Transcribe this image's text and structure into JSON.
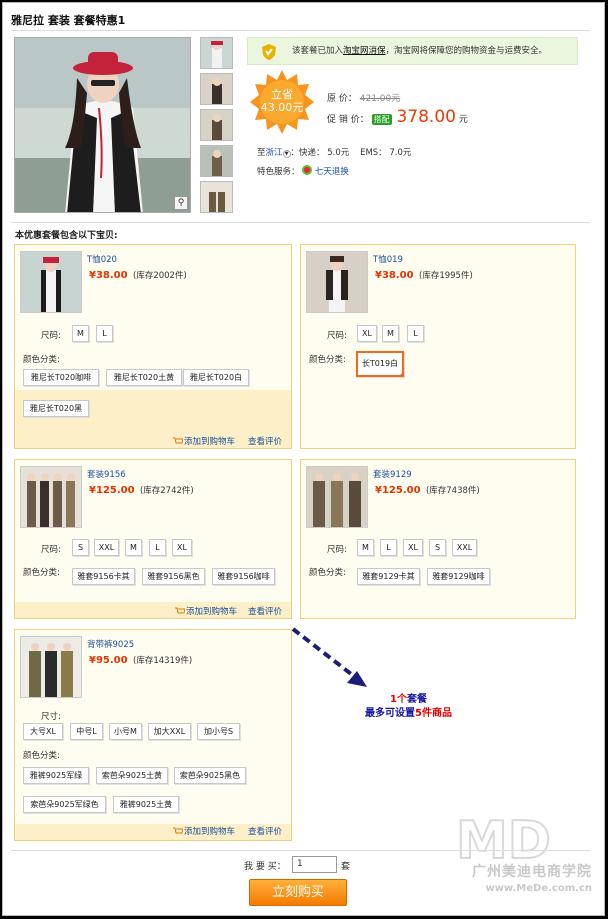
{
  "title": "雅尼拉  套装  套餐特惠1",
  "notice": {
    "prefix": "该套餐已加入",
    "link": "淘宝网消保",
    "suffix": "，淘宝网将保障您的购物资金与运费安全。"
  },
  "savings": {
    "line1": "立省",
    "line2": "43.00元"
  },
  "price": {
    "original_label": "原       价：",
    "original_value": "421.00元",
    "promo_label": "促 销 价：",
    "promo_tag": "搭配",
    "promo_value": "378.00",
    "promo_unit": "元"
  },
  "shipping": {
    "prefix": "至",
    "region": "浙江",
    "express": "：快递： 5.0元",
    "ems": "EMS： 7.0元"
  },
  "service": {
    "label": "特色服务：",
    "link": "七天退换"
  },
  "includes_label": "本优惠套餐包含以下宝贝:",
  "items": [
    {
      "name": "T恤020",
      "price": "¥38.00",
      "stock": "(库存2002件)",
      "size_label": "尺码:",
      "sizes": [
        "M",
        "L"
      ],
      "color_label": "颜色分类:",
      "colors": [
        "雅尼长T020咖啡",
        "雅尼长T020土黄",
        "雅尼长T020白",
        "雅尼长T020黑"
      ],
      "cart": "添加到购物车",
      "review": "查看评价"
    },
    {
      "name": "T恤019",
      "price": "¥38.00",
      "stock": "(库存1995件)",
      "size_label": "尺码:",
      "sizes": [
        "XL",
        "M",
        "L"
      ],
      "color_label": "颜色分类:",
      "colors": [
        "长T019白"
      ]
    },
    {
      "name": "套装9156",
      "price": "¥125.00",
      "stock": "(库存2742件)",
      "size_label": "尺码:",
      "sizes": [
        "S",
        "XXL",
        "M",
        "L",
        "XL"
      ],
      "color_label": "颜色分类:",
      "colors": [
        "雅套9156卡其",
        "雅套9156黑色",
        "雅套9156咖啡"
      ],
      "cart": "添加到购物车",
      "review": "查看评价"
    },
    {
      "name": "套装9129",
      "price": "¥125.00",
      "stock": "(库存7438件)",
      "size_label": "尺码:",
      "sizes": [
        "M",
        "L",
        "XL",
        "S",
        "XXL"
      ],
      "color_label": "颜色分类:",
      "colors": [
        "雅套9129卡其",
        "雅套9129咖啡"
      ]
    },
    {
      "name": "背带裤9025",
      "price": "¥95.00",
      "stock": "(库存14319件)",
      "size_label": "尺寸:",
      "sizes": [
        "大号XL",
        "中号L",
        "小号M",
        "加大XXL",
        "加小号S"
      ],
      "color_label": "颜色分类:",
      "colors": [
        "雅裤9025军绿",
        "索芭朵9025土黄",
        "索芭朵9025黑色",
        "索芭朵9025军绿色",
        "雅裤9025土黄"
      ],
      "cart": "添加到购物车",
      "review": "查看评价"
    }
  ],
  "annotation": {
    "line1_a": "1个",
    "line1_b": "套餐",
    "line2_a": "最多可设置",
    "line2_b": "5件商品"
  },
  "quantity": {
    "label": "我 要 买：",
    "value": "1",
    "unit": "套"
  },
  "buy_button": "立刻购买",
  "watermark": {
    "cn": "广州美迪电商学院",
    "url": "www.MeDe.com.cn"
  },
  "colors": {
    "accent": "#f57a00",
    "price_red": "#e63200",
    "link_blue": "#1a4fa0",
    "card_border": "#f0d27a"
  }
}
